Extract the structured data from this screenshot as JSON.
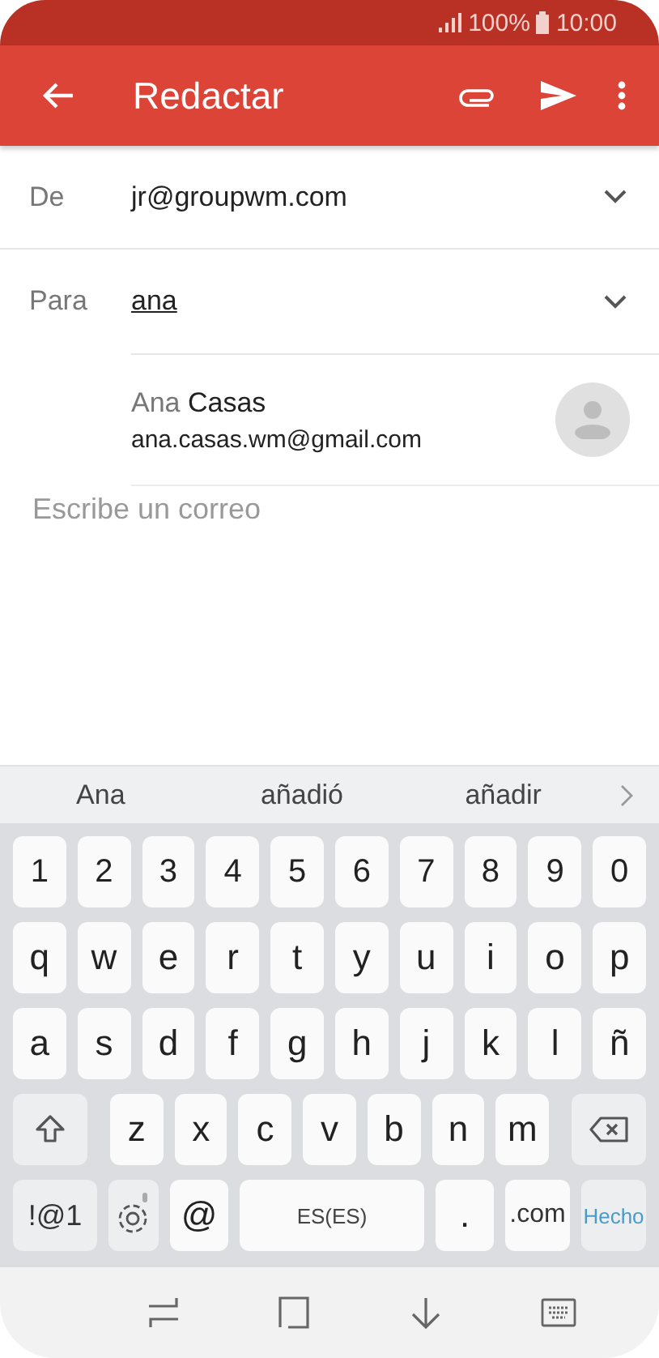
{
  "status_bar": {
    "battery": "100%",
    "time": "10:00"
  },
  "app_bar": {
    "title": "Redactar"
  },
  "fields": [
    {
      "label": "De",
      "value": "jr@groupwm.com",
      "underlined": false
    },
    {
      "label": "Para",
      "value": "ana",
      "underlined": true
    }
  ],
  "contact_suggestion": {
    "name_match": "Ana",
    "name_rest": "Casas",
    "email": "ana.casas.wm@gmail.com"
  },
  "body": {
    "placeholder": "Escribe un correo"
  },
  "word_suggestions": [
    "Ana",
    "añadió",
    "añadir"
  ],
  "keyboard_rows": [
    [
      {
        "kind": "char",
        "label": "1"
      },
      {
        "kind": "char",
        "label": "2"
      },
      {
        "kind": "char",
        "label": "3"
      },
      {
        "kind": "char",
        "label": "4"
      },
      {
        "kind": "char",
        "label": "5"
      },
      {
        "kind": "char",
        "label": "6"
      },
      {
        "kind": "char",
        "label": "7"
      },
      {
        "kind": "char",
        "label": "8"
      },
      {
        "kind": "char",
        "label": "9"
      },
      {
        "kind": "char",
        "label": "0"
      }
    ],
    [
      {
        "kind": "char",
        "label": "q"
      },
      {
        "kind": "char",
        "label": "w"
      },
      {
        "kind": "char",
        "label": "e"
      },
      {
        "kind": "char",
        "label": "r"
      },
      {
        "kind": "char",
        "label": "t"
      },
      {
        "kind": "char",
        "label": "y"
      },
      {
        "kind": "char",
        "label": "u"
      },
      {
        "kind": "char",
        "label": "i"
      },
      {
        "kind": "char",
        "label": "o"
      },
      {
        "kind": "char",
        "label": "p"
      }
    ],
    [
      {
        "kind": "char",
        "label": "a"
      },
      {
        "kind": "char",
        "label": "s"
      },
      {
        "kind": "char",
        "label": "d"
      },
      {
        "kind": "char",
        "label": "f"
      },
      {
        "kind": "char",
        "label": "g"
      },
      {
        "kind": "char",
        "label": "h"
      },
      {
        "kind": "char",
        "label": "j"
      },
      {
        "kind": "char",
        "label": "k"
      },
      {
        "kind": "char",
        "label": "l"
      },
      {
        "kind": "char",
        "label": "ñ"
      }
    ],
    [
      {
        "kind": "shift"
      },
      {
        "kind": "char",
        "label": "z"
      },
      {
        "kind": "char",
        "label": "x"
      },
      {
        "kind": "char",
        "label": "c"
      },
      {
        "kind": "char",
        "label": "v"
      },
      {
        "kind": "char",
        "label": "b"
      },
      {
        "kind": "char",
        "label": "n"
      },
      {
        "kind": "char",
        "label": "m"
      },
      {
        "kind": "backspace"
      }
    ],
    [
      {
        "kind": "symbols",
        "label": "!@1"
      },
      {
        "kind": "settings"
      },
      {
        "kind": "char",
        "label": "@"
      },
      {
        "kind": "space",
        "label": "ES(ES)"
      },
      {
        "kind": "char",
        "label": "."
      },
      {
        "kind": "domain",
        "label": ".com"
      },
      {
        "kind": "action",
        "label": "Hecho"
      }
    ]
  ]
}
